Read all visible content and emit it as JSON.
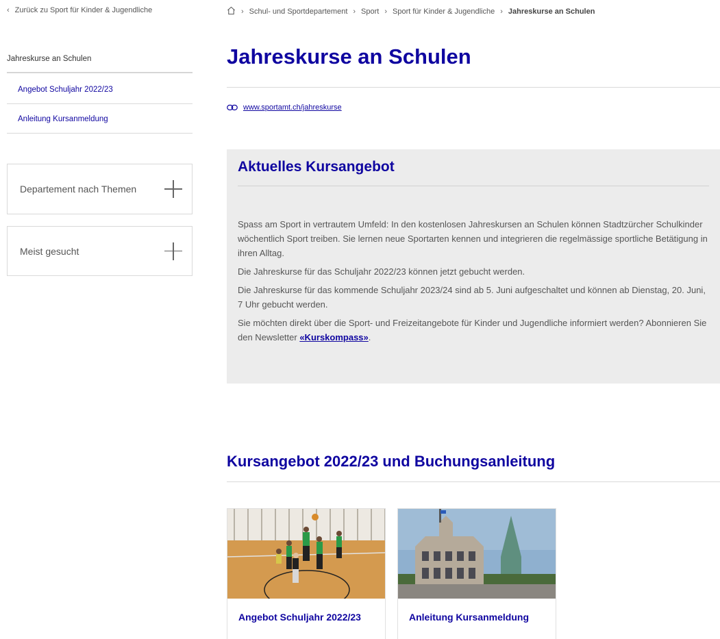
{
  "sidebar": {
    "back_label": "Zurück zu Sport für Kinder & Jugendliche",
    "title": "Jahreskurse an Schulen",
    "items": [
      {
        "label": "Angebot Schuljahr 2022/23"
      },
      {
        "label": "Anleitung Kursanmeldung"
      }
    ],
    "accordions": [
      {
        "label": "Departement nach Themen"
      },
      {
        "label": "Meist gesucht"
      }
    ]
  },
  "breadcrumb": {
    "items": [
      "Schul- und Sportdepartement",
      "Sport",
      "Sport für Kinder & Jugendliche"
    ],
    "current": "Jahreskurse an Schulen"
  },
  "main": {
    "title": "Jahreskurse an Schulen",
    "external_link": "www.sportamt.ch/jahreskurse",
    "panel": {
      "heading": "Aktuelles Kursangebot",
      "p1": "Spass am Sport in vertrautem Umfeld: In den kostenlosen Jahreskursen an Schulen können Stadtzürcher Schulkinder wöchentlich Sport treiben. Sie lernen neue Sportarten kennen und integrieren die regelmässige sportliche Betätigung in ihren Alltag.",
      "p2": "Die Jahreskurse für das Schuljahr 2022/23 können jetzt gebucht werden.",
      "p3": "Die Jahreskurse für das kommende Schuljahr 2023/24 sind ab 5. Juni aufgeschaltet und können ab Dienstag, 20. Juni, 7 Uhr gebucht werden.",
      "p4_text": "Sie möchten direkt über die Sport- und Freizeitangebote für Kinder und Jugendliche informiert werden? Abonnieren Sie den Newsletter ",
      "p4_link": "«Kurskompass»",
      "p4_end": "."
    },
    "section_title": "Kursangebot 2022/23 und Buchungsanleitung",
    "cards": [
      {
        "caption": "Angebot Schuljahr 2022/23"
      },
      {
        "caption": "Anleitung Kursanmeldung"
      }
    ]
  },
  "colors": {
    "accent": "#0f05a0",
    "panel_bg": "#ececec",
    "border": "#d9d9d9"
  }
}
